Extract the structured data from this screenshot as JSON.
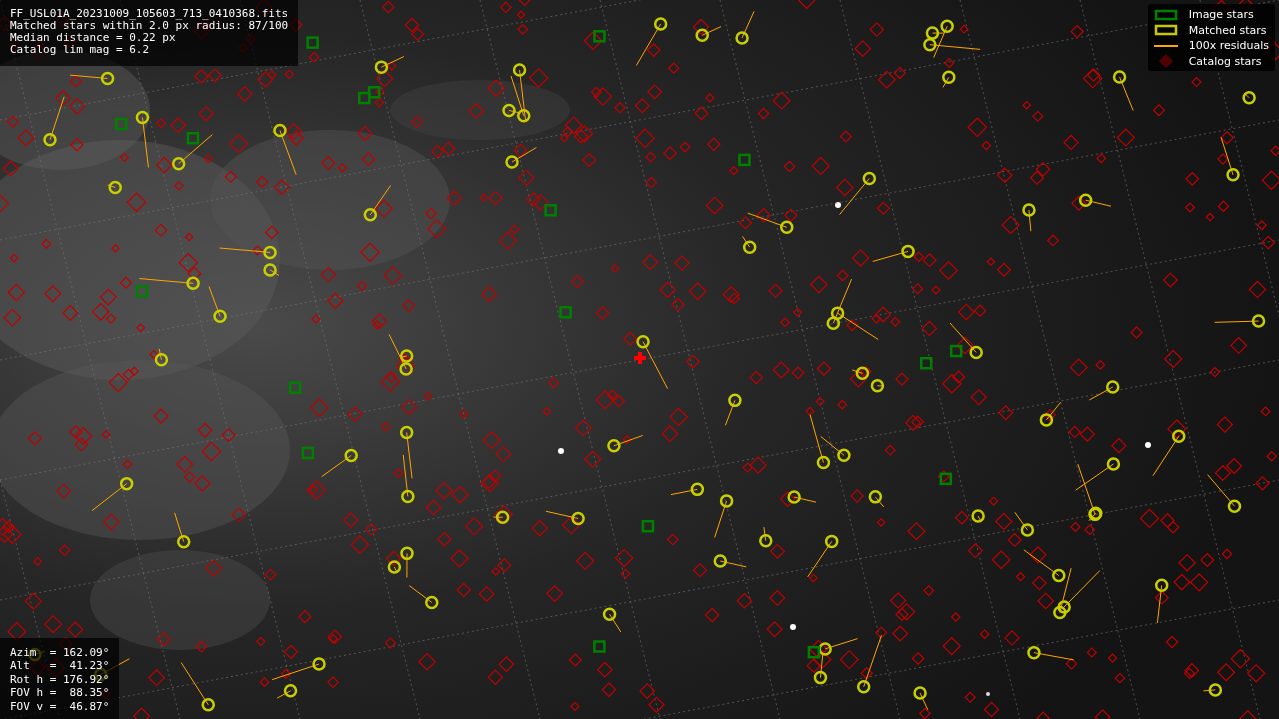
{
  "header": {
    "lines": [
      "FF_USL01A_20231009_105603_713_0410368.fits",
      "Matched stars within 2.0 px radius: 87/100",
      "Median distance = 0.22 px",
      "Catalog lim mag = 6.2"
    ]
  },
  "legend": [
    {
      "label": "Image stars",
      "kind": "box",
      "color": "#008000"
    },
    {
      "label": "Matched stars",
      "kind": "box",
      "color": "#c8c800"
    },
    {
      "label": "100x residuals",
      "kind": "line",
      "color": "#ffa500"
    },
    {
      "label": "Catalog stars",
      "kind": "diamond",
      "color": "#500000"
    }
  ],
  "pointing": {
    "lines": [
      "Azim  = 162.09°",
      "Alt   =  41.23°",
      "Rot h = 176.92°",
      "FOV h =  88.35°",
      "FOV v =  46.87°"
    ]
  }
}
